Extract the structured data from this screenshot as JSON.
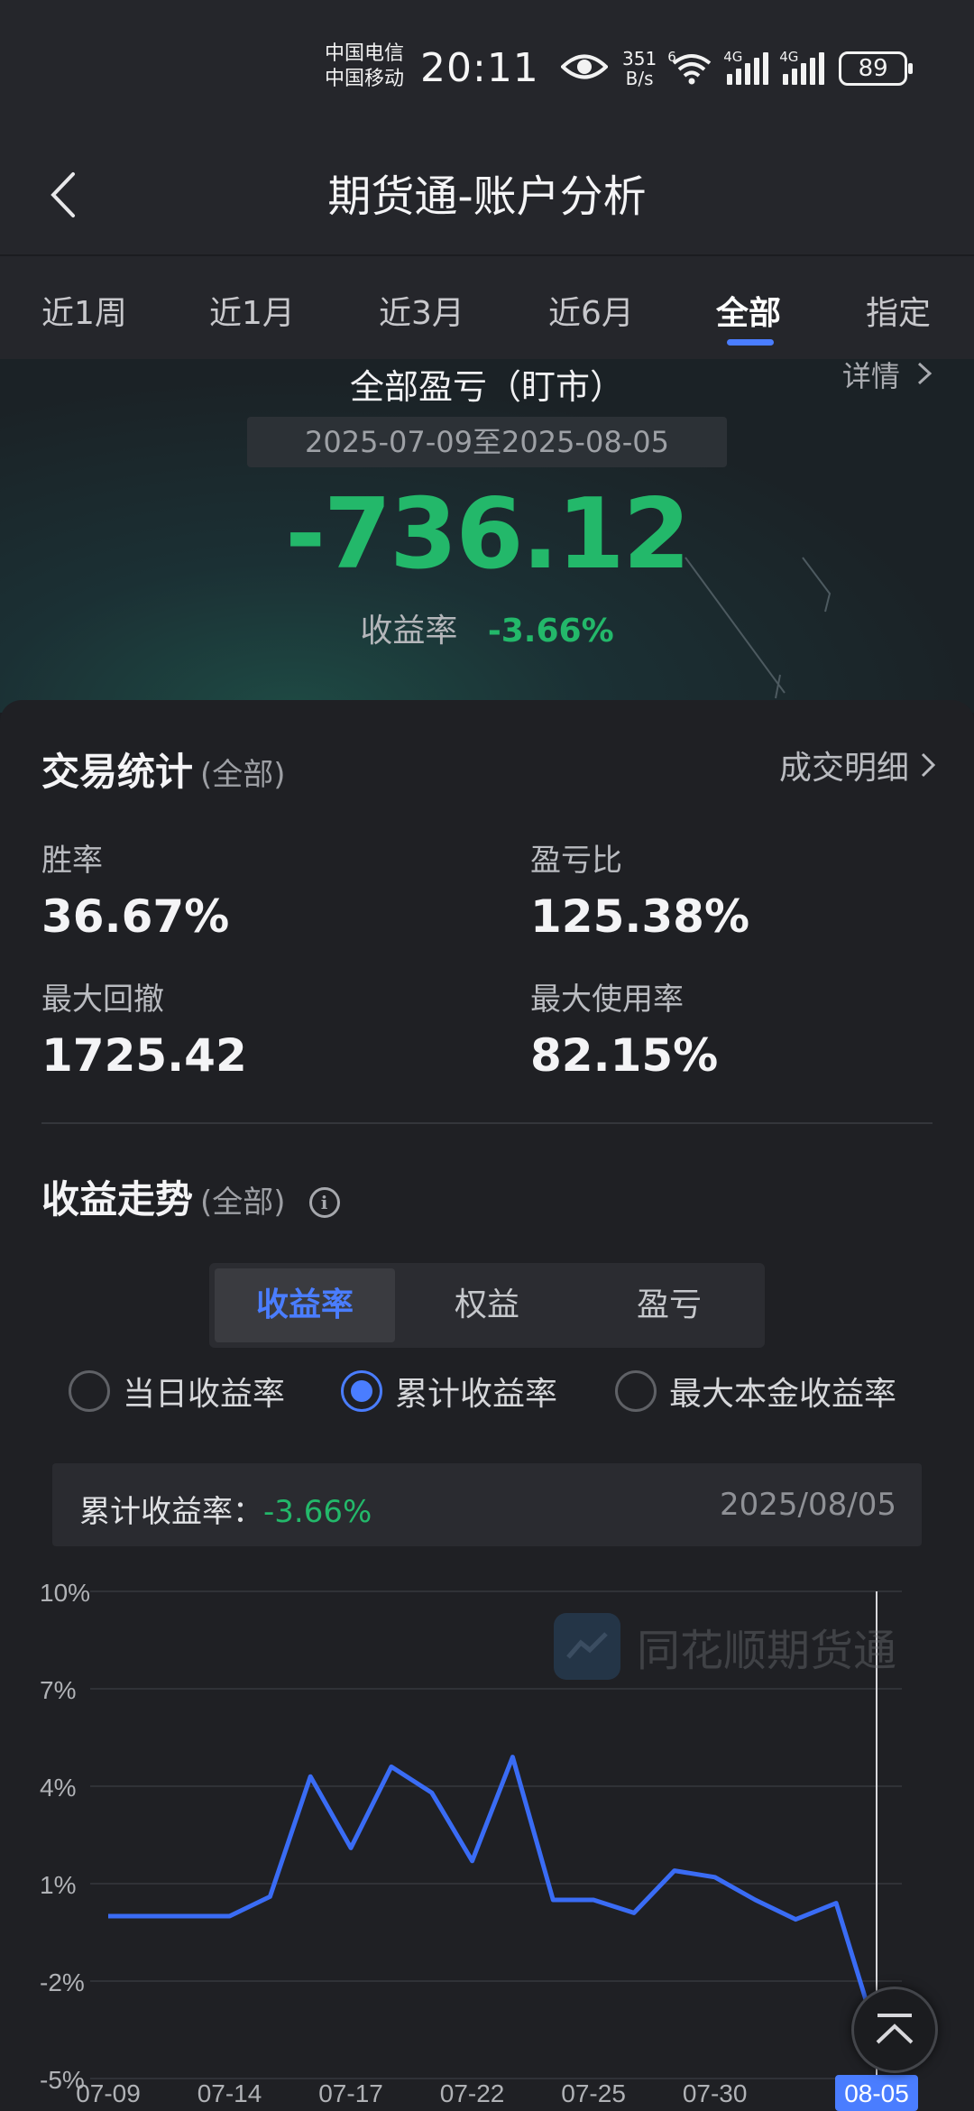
{
  "status_bar": {
    "carrier1": "中国电信",
    "carrier2": "中国移动",
    "time": "20:11",
    "net_speed_value": "351",
    "net_speed_unit": "B/s",
    "wifi_tag": "6",
    "sig1_tag": "4G",
    "sig2_tag": "4G",
    "battery": "89"
  },
  "header": {
    "title": "期货通-账户分析"
  },
  "tabs": [
    {
      "label": "近1周"
    },
    {
      "label": "近1月"
    },
    {
      "label": "近3月"
    },
    {
      "label": "近6月"
    },
    {
      "label": "全部",
      "active": true
    },
    {
      "label": "指定"
    }
  ],
  "summary": {
    "title": "全部盈亏（盯市）",
    "detail_link": "详情",
    "date_range": "2025-07-09至2025-08-05",
    "pnl": "-736.12",
    "rate_label": "收益率",
    "rate_value": "-3.66%"
  },
  "trade_stats": {
    "title": "交易统计",
    "subtitle": "(全部)",
    "link": "成交明细",
    "win_rate_label": "胜率",
    "win_rate": "36.67%",
    "pl_ratio_label": "盈亏比",
    "pl_ratio": "125.38%",
    "max_drawdown_label": "最大回撤",
    "max_drawdown": "1725.42",
    "max_usage_label": "最大使用率",
    "max_usage": "82.15%"
  },
  "trend": {
    "title": "收益走势",
    "subtitle": "(全部)",
    "info_glyph": "i",
    "segments": [
      "收益率",
      "权益",
      "盈亏"
    ],
    "active_segment": 0,
    "radios": [
      "当日收益率",
      "累计收益率",
      "最大本金收益率"
    ],
    "active_radio": 1,
    "tooltip_label": "累计收益率：",
    "tooltip_value": "-3.66%",
    "tooltip_date": "2025/08/05",
    "watermark": "同花顺期货通"
  },
  "colors": {
    "accent": "#4a7dff",
    "loss_green": "#23b86a",
    "line": "#3a6cf5"
  },
  "chart_data": {
    "type": "line",
    "ylabel": "",
    "xlabel": "",
    "y_ticks": [
      "10%",
      "7%",
      "4%",
      "1%",
      "-2%",
      "-5%"
    ],
    "y_tick_values": [
      10,
      7,
      4,
      1,
      -2,
      -5
    ],
    "ylim": [
      -5,
      10
    ],
    "x_tick_labels": [
      "07-09",
      "07-14",
      "07-17",
      "07-22",
      "07-25",
      "07-30",
      "08-05"
    ],
    "x_tick_index": [
      0,
      3,
      6,
      9,
      12,
      15,
      19
    ],
    "highlight_label": "08-05",
    "grid": true,
    "series": [
      {
        "values": [
          0,
          0,
          0,
          0,
          0.6,
          4.3,
          2.1,
          4.6,
          3.8,
          1.7,
          4.9,
          0.5,
          0.5,
          0.1,
          1.4,
          1.2,
          0.5,
          -0.1,
          0.4,
          -3.66
        ]
      }
    ]
  }
}
